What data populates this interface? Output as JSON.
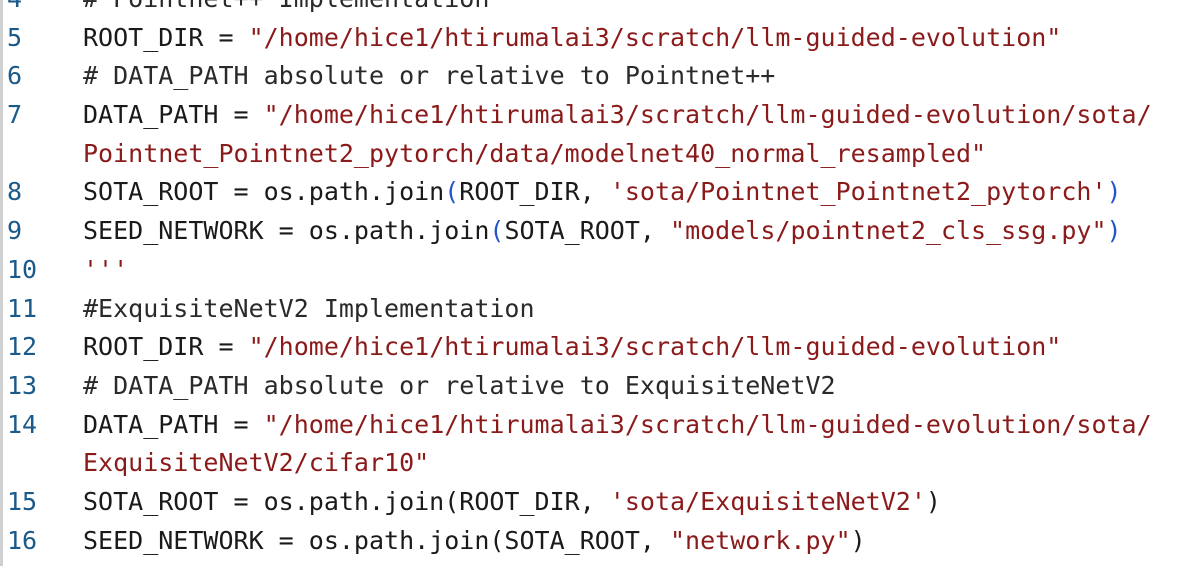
{
  "lines": [
    {
      "num": "4",
      "parts": [
        {
          "t": "# Pointnet++ Implementation",
          "c": "comment"
        }
      ]
    },
    {
      "num": "5",
      "parts": [
        {
          "t": "ROOT_DIR = ",
          "c": ""
        },
        {
          "t": "\"/home/hice1/htirumalai3/scratch/llm-guided-evolution\"",
          "c": "str"
        }
      ]
    },
    {
      "num": "6",
      "parts": [
        {
          "t": "# DATA_PATH absolute or relative to Pointnet++",
          "c": "comment"
        }
      ]
    },
    {
      "num": "7",
      "parts": [
        {
          "t": "DATA_PATH = ",
          "c": ""
        },
        {
          "t": "\"/home/hice1/htirumalai3/scratch/llm-guided-evolution/sota/",
          "c": "str"
        }
      ]
    },
    {
      "num": "",
      "parts": [
        {
          "t": "Pointnet_Pointnet2_pytorch/data/modelnet40_normal_resampled\"",
          "c": "str"
        }
      ]
    },
    {
      "num": "8",
      "parts": [
        {
          "t": "SOTA_ROOT = os.path.join",
          "c": ""
        },
        {
          "t": "(",
          "c": "paren"
        },
        {
          "t": "ROOT_DIR, ",
          "c": ""
        },
        {
          "t": "'sota/Pointnet_Pointnet2_pytorch'",
          "c": "str"
        },
        {
          "t": ")",
          "c": "paren"
        }
      ]
    },
    {
      "num": "9",
      "parts": [
        {
          "t": "SEED_NETWORK = os.path.join",
          "c": ""
        },
        {
          "t": "(",
          "c": "paren"
        },
        {
          "t": "SOTA_ROOT, ",
          "c": ""
        },
        {
          "t": "\"models/pointnet2_cls_ssg.py\"",
          "c": "str"
        },
        {
          "t": ")",
          "c": "paren"
        }
      ]
    },
    {
      "num": "10",
      "parts": [
        {
          "t": "'''",
          "c": "str"
        }
      ]
    },
    {
      "num": "11",
      "parts": [
        {
          "t": "#ExquisiteNetV2 Implementation",
          "c": "comment"
        }
      ]
    },
    {
      "num": "12",
      "parts": [
        {
          "t": "ROOT_DIR = ",
          "c": ""
        },
        {
          "t": "\"/home/hice1/htirumalai3/scratch/llm-guided-evolution\"",
          "c": "str"
        }
      ]
    },
    {
      "num": "13",
      "parts": [
        {
          "t": "# DATA_PATH absolute or relative to ExquisiteNetV2",
          "c": "comment"
        }
      ]
    },
    {
      "num": "14",
      "parts": [
        {
          "t": "DATA_PATH = ",
          "c": ""
        },
        {
          "t": "\"/home/hice1/htirumalai3/scratch/llm-guided-evolution/sota/",
          "c": "str"
        }
      ]
    },
    {
      "num": "",
      "parts": [
        {
          "t": "ExquisiteNetV2/cifar10\"",
          "c": "str"
        }
      ]
    },
    {
      "num": "15",
      "parts": [
        {
          "t": "SOTA_ROOT = os.path.join(ROOT_DIR, ",
          "c": ""
        },
        {
          "t": "'sota/ExquisiteNetV2'",
          "c": "str"
        },
        {
          "t": ")",
          "c": ""
        }
      ]
    },
    {
      "num": "16",
      "parts": [
        {
          "t": "SEED_NETWORK = os.path.join(SOTA_ROOT, ",
          "c": ""
        },
        {
          "t": "\"network.py\"",
          "c": "str"
        },
        {
          "t": ")",
          "c": ""
        }
      ]
    }
  ]
}
